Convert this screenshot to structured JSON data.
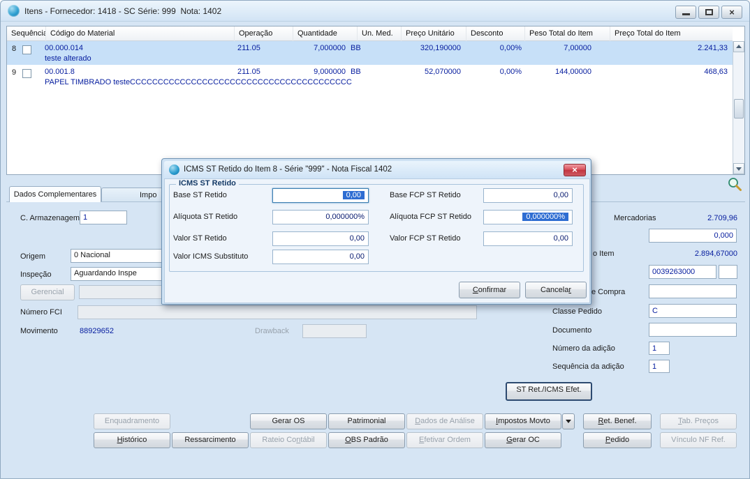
{
  "window": {
    "title": "Itens - Fornecedor: 1418 - SC Série: 999  Nota: 1402"
  },
  "icons": {
    "close": "×",
    "minimize": "minimize-bar",
    "maximize": "maximize-box",
    "dropdown": "dropdown-arrow",
    "magnifier": "zoom-magnifier"
  },
  "grid": {
    "columns": [
      "Sequência",
      "Código do Material",
      "Operação",
      "Quantidade",
      "Un. Med.",
      "Preço Unitário",
      "Desconto",
      "Peso Total do Item",
      "Preço Total do Item"
    ],
    "rows": [
      {
        "seq": "8",
        "checked": false,
        "code": "00.000.014",
        "description": "teste alterado",
        "operation": "211.05",
        "quantity": "7,000000",
        "unit": "BB",
        "unit_price": "320,190000",
        "discount": "0,00%",
        "weight_total": "7,00000",
        "price_total": "2.241,33",
        "selected": true
      },
      {
        "seq": "9",
        "checked": false,
        "code": "00.001.8",
        "description": "PAPEL TIMBRADO testeCCCCCCCCCCCCCCCCCCCCCCCCCCCCCCCCCCCCCCCC",
        "operation": "211.05",
        "quantity": "9,000000",
        "unit": "BB",
        "unit_price": "52,070000",
        "discount": "0,00%",
        "weight_total": "144,00000",
        "price_total": "468,63",
        "selected": false
      }
    ]
  },
  "tabs": {
    "active": "Dados Complementares",
    "second": "Impo"
  },
  "panel": {
    "left": {
      "armazenagem_label": "C. Armazenagem",
      "armazenagem_value": "1",
      "origem_label": "Origem",
      "origem_value": "0 Nacional",
      "inspecao_label": "Inspeção",
      "inspecao_value": "Aguardando Inspe",
      "gerencial_button": "Gerencial",
      "numero_fci_label": "Número FCI",
      "numero_fci_value": "",
      "movimento_label": "Movimento",
      "movimento_value": "88929652",
      "drawback_label": "Drawback",
      "drawback_value": ""
    },
    "right": {
      "mercadorias_label": "Mercadorias",
      "mercadorias_value": "2.709,96",
      "peso_field_value": "0,000",
      "item_label": "o Item",
      "item_value": "2.894,67000",
      "codigo_field_value": "0039263000",
      "codigo_field2_value": "",
      "compra_label": "e Compra",
      "compra_value": "",
      "classe_pedido_label": "Classe Pedido",
      "classe_pedido_value": "C",
      "documento_label": "Documento",
      "documento_value": "",
      "numero_adicao_label": "Número da adição",
      "numero_adicao_value": "1",
      "sequencia_adicao_label": "Sequência da adição",
      "sequencia_adicao_value": "1",
      "st_ret_button": "ST Ret./ICMS Efet."
    }
  },
  "dialog": {
    "title": "ICMS ST Retido do Item 8 - Série \"999\" - Nota Fiscal 1402",
    "group": "ICMS ST Retido",
    "fields": {
      "base_st": {
        "label": "Base ST Retido",
        "value": "0,00"
      },
      "base_fcp": {
        "label": "Base FCP ST Retido",
        "value": "0,00"
      },
      "aliquota_st": {
        "label": "Alíquota ST Retido",
        "value": "0,000000%"
      },
      "aliquota_fcp": {
        "label": "Alíquota FCP ST Retido",
        "value": "0,000000%"
      },
      "valor_st": {
        "label": "Valor ST Retido",
        "value": "0,00"
      },
      "valor_fcp": {
        "label": "Valor FCP ST Retido",
        "value": "0,00"
      },
      "valor_icms_substituto": {
        "label": "Valor ICMS Substituto",
        "value": "0,00"
      }
    },
    "buttons": {
      "confirm": {
        "label": "Confirmar",
        "key": "C"
      },
      "cancel": {
        "label": "Cancelar",
        "key": "r"
      }
    }
  },
  "footer": {
    "row1": [
      {
        "label": "Enquadramento",
        "key": "",
        "disabled": true
      },
      {
        "label": "Gerar OS",
        "key": "",
        "disabled": false
      },
      {
        "label": "Patrimonial",
        "key": "",
        "disabled": false
      },
      {
        "label": "Dados de Análise",
        "key": "D",
        "disabled": true
      },
      {
        "label": "Impostos Movto",
        "key": "I",
        "disabled": false
      },
      {
        "label": "Ret. Benef.",
        "key": "R",
        "disabled": false
      },
      {
        "label": "Tab. Preços",
        "key": "T",
        "disabled": true
      }
    ],
    "row2": [
      {
        "label": "Histórico",
        "key": "H",
        "disabled": false
      },
      {
        "label": "Ressarcimento",
        "key": "",
        "disabled": false
      },
      {
        "label": "Rateio Contábil",
        "key": "n",
        "disabled": true
      },
      {
        "label": "OBS Padrão",
        "key": "O",
        "disabled": false
      },
      {
        "label": "Efetivar Ordem",
        "key": "E",
        "disabled": true
      },
      {
        "label": "Gerar OC",
        "key": "G",
        "disabled": false
      },
      {
        "label": "Pedido",
        "key": "P",
        "disabled": false
      },
      {
        "label": "Vínculo NF Ref.",
        "key": "",
        "disabled": true
      }
    ]
  },
  "colors": {
    "window_bg": "#d6e5f4",
    "selected_row": "#c7e0f8",
    "value_text": "#051c9e",
    "selection_bg": "#2e6dd2",
    "disabled_text": "#98a2ac",
    "close_button": "#c9363f"
  }
}
